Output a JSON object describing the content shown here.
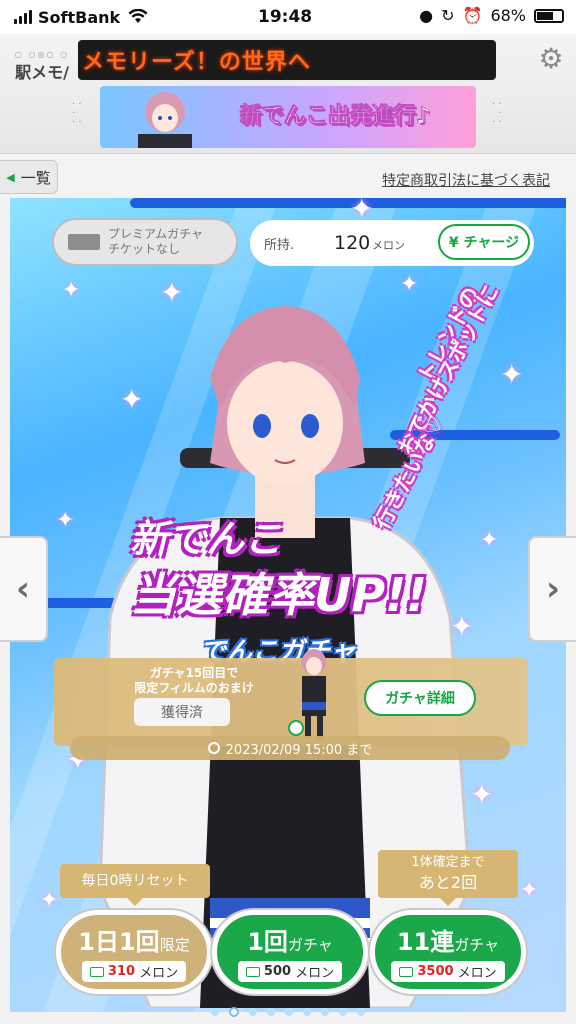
{
  "status_bar": {
    "carrier": "SoftBank",
    "time": "19:48",
    "battery": "68%"
  },
  "header": {
    "logo": "駅メモ/",
    "ticker": "メモリーズ！の世界へ",
    "banner_title": "新でんこ出発進行♪"
  },
  "nav": {
    "back_label": "一覧",
    "legal_link": "特定商取引法に基づく表記"
  },
  "wallet": {
    "ticket_text_1": "プレミアムガチャ",
    "ticket_text_2": "チケットなし",
    "owned_label": "所持.",
    "amount": "120",
    "unit": "メロン",
    "charge_label": "¥ チャージ"
  },
  "promo": {
    "bubble_lines": [
      "トレンドの",
      "おでかけスポットに",
      "行きたいな♡"
    ],
    "headline_1": "新でんこ",
    "headline_2": "当選確率UP!!",
    "headline_3": "でんこガチャ"
  },
  "bonus": {
    "line1": "ガチャ15回目で",
    "line2": "限定フィルムのおまけ",
    "claimed": "獲得済",
    "detail_button": "ガチャ詳細",
    "deadline": "2023/02/09 15:00 まで"
  },
  "tags": {
    "daily_reset": "毎日0時リセット",
    "guarantee_line1": "1体確定まで",
    "guarantee_line2": "あと2回"
  },
  "buttons": [
    {
      "main": "1日1回",
      "suffix": "限定",
      "price": "310",
      "unit": "メロン"
    },
    {
      "main": "1回",
      "suffix": "ガチャ",
      "price": "500",
      "unit": "メロン"
    },
    {
      "main": "11連",
      "suffix": "ガチャ",
      "price": "3500",
      "unit": "メロン"
    }
  ],
  "pager": {
    "count": 9,
    "active": 1
  },
  "colors": {
    "accent_green": "#1ba84a",
    "gold": "#cfb27a",
    "ticker_orange": "#ff6a1a",
    "headline_purple": "#b321c0"
  }
}
